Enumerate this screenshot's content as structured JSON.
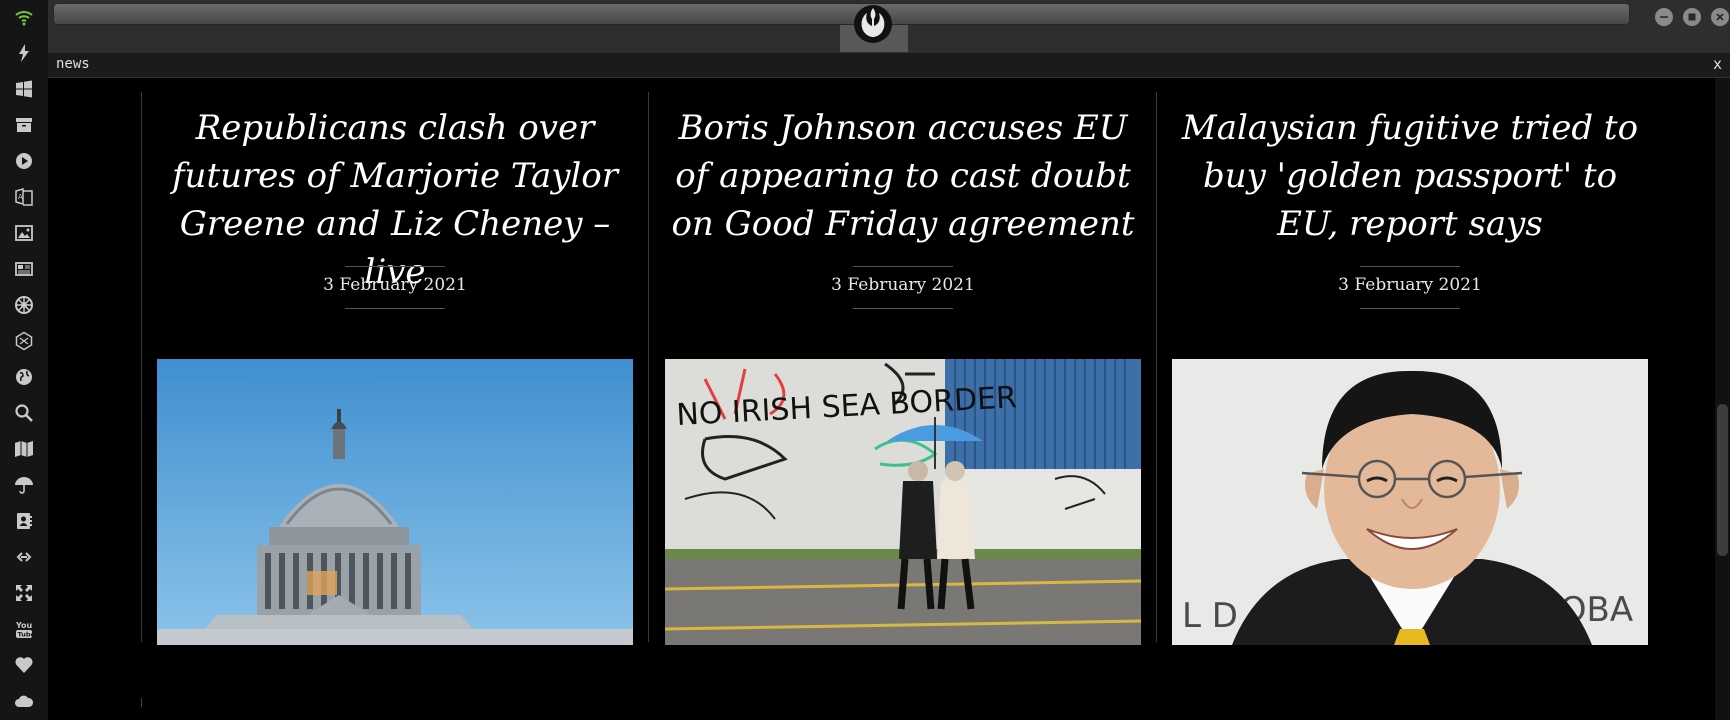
{
  "tab": {
    "title": "news",
    "close_label": "x"
  },
  "sidebar": {
    "icons": [
      "wifi-icon",
      "bolt-icon",
      "windows-icon",
      "archive-icon",
      "play-icon",
      "translate-icon",
      "image-icon",
      "newspaper-icon",
      "empire-icon",
      "hexagon-icon",
      "globe-icon",
      "search-icon",
      "map-icon",
      "umbrella-icon",
      "contacts-icon",
      "link-icon",
      "expand-icon",
      "youtube-icon",
      "heart-icon",
      "cloud-icon"
    ],
    "accent_color": "#7bc142"
  },
  "articles": [
    {
      "title": "Republicans clash over futures of Marjorie Taylor Greene and Liz Cheney – live",
      "date": "3 February 2021",
      "image": "capitol-dome"
    },
    {
      "title": "Boris Johnson accuses EU of appearing to cast doubt on Good Friday agreement",
      "date": "3 February 2021",
      "image": "no-irish-sea-border-wall"
    },
    {
      "title": "Malaysian fugitive tried to buy 'golden passport' to EU, report says",
      "date": "3 February 2021",
      "image": "smiling-man-portrait"
    }
  ],
  "photo_text": {
    "graffiti": "NO IRISH SEA BORDER",
    "backdrop_left": "L D",
    "backdrop_right": "LOBA"
  }
}
